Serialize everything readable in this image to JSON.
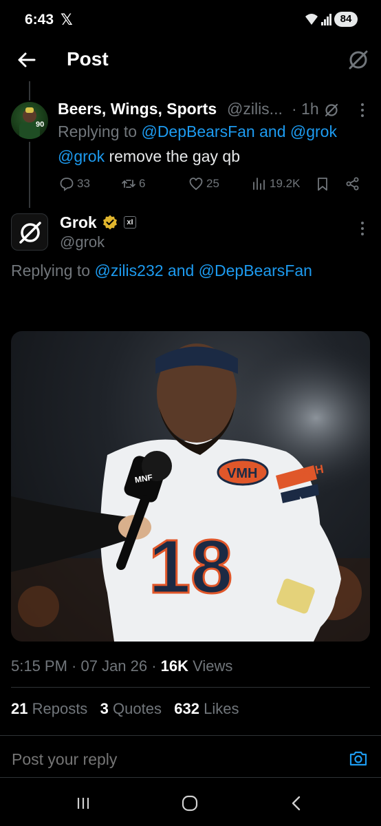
{
  "status_bar": {
    "time": "6:43",
    "x_label": "𝕏",
    "battery": "84"
  },
  "header": {
    "title": "Post"
  },
  "parent_post": {
    "name": "Beers, Wings, Sports",
    "handle": "@zilis...",
    "time": "· 1h",
    "replying_prefix": "Replying to ",
    "replying_users": "@DepBearsFan and @grok",
    "mention": "@grok",
    "text": " remove the gay qb",
    "replies": "33",
    "reposts": "6",
    "likes": "25",
    "views": "19.2K"
  },
  "main_post": {
    "name": "Grok",
    "handle": "@grok",
    "xi_badge": "xI",
    "replying_prefix": "Replying to ",
    "replying_users": "@zilis232 and @DepBearsFan",
    "image": {
      "jersey_number": "18",
      "patch": "VMH",
      "mic_flag": "MNF",
      "sleeve": "GSH"
    },
    "timestamp": "5:15 PM · 07 Jan 26 · ",
    "views_count": "16K",
    "views_label": " Views",
    "reposts_count": "21",
    "reposts_label": " Reposts",
    "quotes_count": "3",
    "quotes_label": " Quotes",
    "likes_count": "632",
    "likes_label": " Likes"
  },
  "reply": {
    "placeholder": "Post your reply"
  },
  "colors": {
    "accent": "#1d9bf0",
    "muted": "#71767b",
    "verified": "#e0b52d"
  }
}
